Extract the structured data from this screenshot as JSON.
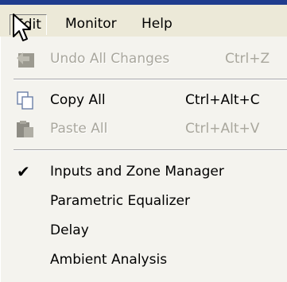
{
  "menubar": {
    "items": [
      {
        "label": "Edit",
        "active": true
      },
      {
        "label": "Monitor"
      },
      {
        "label": "Help"
      }
    ]
  },
  "edit_menu": {
    "undo": {
      "label": "Undo All Changes",
      "shortcut": "Ctrl+Z",
      "enabled": false,
      "icon": "undo-icon"
    },
    "copy_all": {
      "label": "Copy All",
      "shortcut": "Ctrl+Alt+C",
      "enabled": true,
      "icon": "copy-icon"
    },
    "paste_all": {
      "label": "Paste All",
      "shortcut": "Ctrl+Alt+V",
      "enabled": false,
      "icon": "paste-icon"
    },
    "views": [
      {
        "label": "Inputs and Zone Manager",
        "checked": true
      },
      {
        "label": "Parametric Equalizer",
        "checked": false
      },
      {
        "label": "Delay",
        "checked": false
      },
      {
        "label": "Ambient Analysis",
        "checked": false
      }
    ]
  },
  "colors": {
    "menu_bg": "#ece9d8",
    "dropdown_bg": "#f4f3ee",
    "disabled_text": "#a9a79d",
    "title_bar": "#1f3c8e"
  }
}
